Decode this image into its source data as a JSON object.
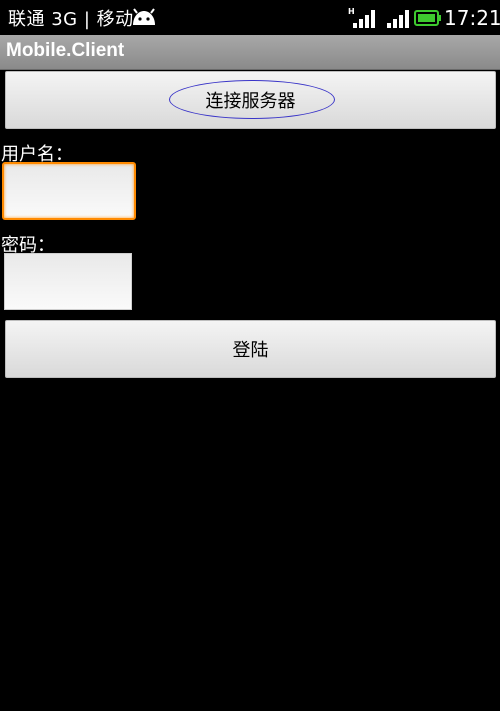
{
  "status_bar": {
    "carrier": "联通 3G | 移动",
    "time": "17:21",
    "signal_1_label": "H"
  },
  "app": {
    "title": "Mobile.Client"
  },
  "form": {
    "connect_button": "连接服务器",
    "username_label": "用户名：",
    "username_value": "",
    "password_label": "密码：",
    "password_value": "",
    "login_button": "登陆"
  },
  "colors": {
    "focus_border": "#ff8a00",
    "highlight_oval": "#3a35c8",
    "battery": "#3ecb2f"
  }
}
